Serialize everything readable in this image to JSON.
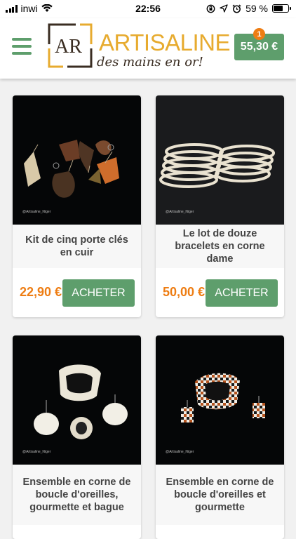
{
  "status_bar": {
    "carrier": "inwi",
    "time": "22:56",
    "battery": "59 %",
    "battery_level": 0.59
  },
  "header": {
    "brand_name": "ARTISALINE",
    "brand_monogram": "AR",
    "tagline": "des mains en or!",
    "cart_total": "55,30 €",
    "cart_count": "1"
  },
  "products": [
    {
      "title": "Kit de cinq porte clés en cuir",
      "price": "22,90 €",
      "button": "ACHETER",
      "watermark": "@Artisaline_Niger"
    },
    {
      "title": "Le lot de douze bracelets en corne dame",
      "price": "50,00 €",
      "button": "ACHETER",
      "watermark": "@Artisaline_Niger"
    },
    {
      "title": "Ensemble en corne de boucle d'oreilles, gourmette et bague",
      "price": "",
      "button": "",
      "watermark": "@Artisaline_Niger"
    },
    {
      "title": "Ensemble en corne de boucle d'oreilles et gourmette",
      "price": "",
      "button": "",
      "watermark": "@Artisaline_Niger"
    }
  ],
  "colors": {
    "accent_green": "#5e9e6c",
    "price_orange": "#ee7d13",
    "logo_gold": "#e7ab2f"
  }
}
